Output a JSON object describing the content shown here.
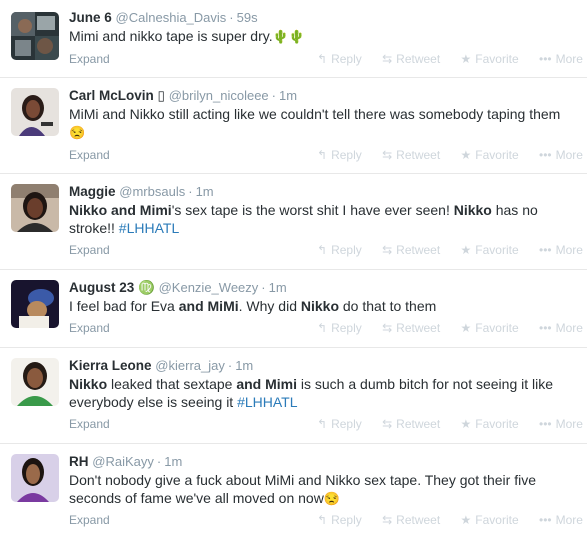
{
  "actions": {
    "reply": "Reply",
    "retweet": "Retweet",
    "favorite": "Favorite",
    "more": "More",
    "expand": "Expand"
  },
  "icons": {
    "reply": "reply-arrow-icon",
    "retweet": "retweet-icon",
    "favorite": "star-icon",
    "more": "ellipsis-icon"
  },
  "colors": {
    "name": "#292f33",
    "meta": "#8899a6",
    "hashtag": "#2b7bb9",
    "action": "#cfd6dc",
    "divider": "#e8e8e8"
  },
  "tweets": [
    {
      "name": "June 6",
      "handle": "@Calneshia_Davis",
      "time": "59s",
      "segments": [
        {
          "t": "Mimi and nikko tape is super dry.",
          "s": "n"
        },
        {
          "t": "🌵🌵",
          "s": "emoji"
        }
      ]
    },
    {
      "name": "Carl McLovin",
      "name_suffix": "▯",
      "handle": "@brilyn_nicoleee",
      "time": "1m",
      "segments": [
        {
          "t": "MiMi and Nikko still acting like we couldn't tell there was somebody taping them ",
          "s": "n"
        },
        {
          "t": "😒",
          "s": "emoji"
        }
      ]
    },
    {
      "name": "Maggie",
      "handle": "@mrbsauls",
      "time": "1m",
      "segments": [
        {
          "t": "Nikko",
          "s": "b"
        },
        {
          "t": " ",
          "s": "n"
        },
        {
          "t": "and",
          "s": "b"
        },
        {
          "t": " ",
          "s": "n"
        },
        {
          "t": "Mimi",
          "s": "b"
        },
        {
          "t": "'s sex tape is the worst shit I have ever seen! ",
          "s": "n"
        },
        {
          "t": "Nikko",
          "s": "b"
        },
        {
          "t": " has no stroke!! ",
          "s": "n"
        },
        {
          "t": "#LHHATL",
          "s": "tag"
        }
      ]
    },
    {
      "name": "August 23",
      "name_suffix": "♍",
      "handle": "@Kenzie_Weezy",
      "time": "1m",
      "segments": [
        {
          "t": "I feel bad for Eva ",
          "s": "n"
        },
        {
          "t": "and",
          "s": "b"
        },
        {
          "t": " ",
          "s": "n"
        },
        {
          "t": "MiMi",
          "s": "b"
        },
        {
          "t": ". Why did ",
          "s": "n"
        },
        {
          "t": "Nikko",
          "s": "b"
        },
        {
          "t": " do that to them",
          "s": "n"
        }
      ]
    },
    {
      "name": "Kierra Leone",
      "handle": "@kierra_jay",
      "time": "1m",
      "segments": [
        {
          "t": "Nikko",
          "s": "b"
        },
        {
          "t": " leaked that sextape ",
          "s": "n"
        },
        {
          "t": "and",
          "s": "b"
        },
        {
          "t": " ",
          "s": "n"
        },
        {
          "t": "Mimi",
          "s": "b"
        },
        {
          "t": " is such a dumb bitch for not seeing it like everybody else is seeing it ",
          "s": "n"
        },
        {
          "t": "#LHHATL",
          "s": "tag"
        }
      ]
    },
    {
      "name": "RH",
      "handle": "@RaiKayy",
      "time": "1m",
      "segments": [
        {
          "t": "Don't nobody give a fuck about MiMi and Nikko sex tape. They got their five seconds of fame we've all moved on now",
          "s": "n"
        },
        {
          "t": "😒",
          "s": "emoji"
        }
      ]
    }
  ]
}
